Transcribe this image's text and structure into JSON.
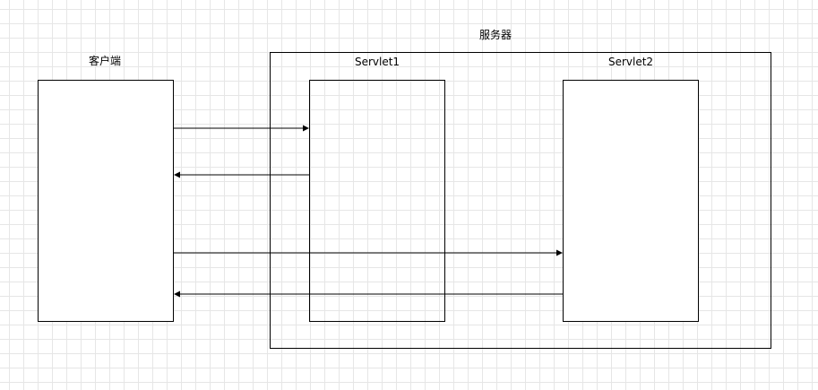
{
  "diagram": {
    "server_label": "服务器",
    "client_label": "客户端",
    "servlet1_label": "Servlet1",
    "servlet2_label": "Servlet2"
  },
  "colors": {
    "stroke": "#000000",
    "grid": "#e6e6e6",
    "background": "#ffffff"
  }
}
